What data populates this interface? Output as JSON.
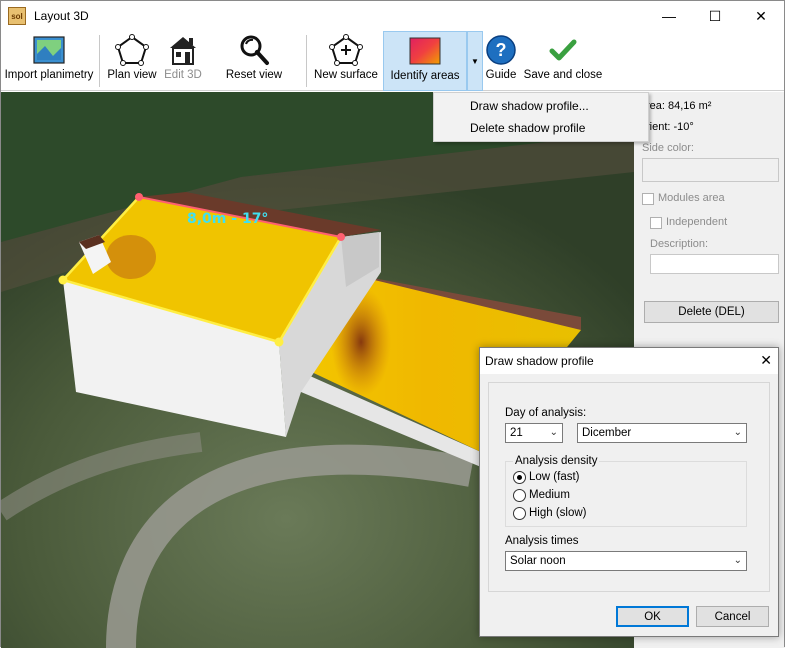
{
  "window": {
    "title": "Layout 3D",
    "logo_text": "sol",
    "controls": {
      "minimize": "—",
      "maximize": "☐",
      "close": "✕"
    }
  },
  "toolbar": {
    "import_planimetry": "Import planimetry",
    "plan_view": "Plan view",
    "edit_3d": "Edit 3D",
    "reset_view": "Reset view",
    "new_surface": "New surface",
    "identify_areas": "Identify areas",
    "guide": "Guide",
    "save_and_close": "Save and close"
  },
  "viewport": {
    "roof_label": "8,0m - 17°"
  },
  "menu": {
    "items": [
      "Draw shadow profile...",
      "Delete shadow profile"
    ]
  },
  "side_panel": {
    "area": "rea: 84,16 m²",
    "orient": "rient: -10°",
    "side_color_label": "Side color:",
    "modules_area": "Modules area",
    "independent": "Independent",
    "description_label": "Description:",
    "delete_button": "Delete (DEL)"
  },
  "dialog": {
    "title": "Draw shadow profile",
    "close": "✕",
    "day_label": "Day of analysis:",
    "day_value": "21",
    "month_value": "Dicember",
    "density_label": "Analysis density",
    "density_options": [
      "Low (fast)",
      "Medium",
      "High (slow)"
    ],
    "density_selected": "Low (fast)",
    "times_label": "Analysis times",
    "times_value": "Solar noon",
    "ok": "OK",
    "cancel": "Cancel"
  },
  "colors": {
    "roof_yellow": "#f0c400",
    "edge_red": "#ff6070",
    "edge_yellow": "#ffee44",
    "label_cyan": "#40e0f0",
    "accent_blue": "#0078d7",
    "menu_highlight": "#cce4f7"
  }
}
